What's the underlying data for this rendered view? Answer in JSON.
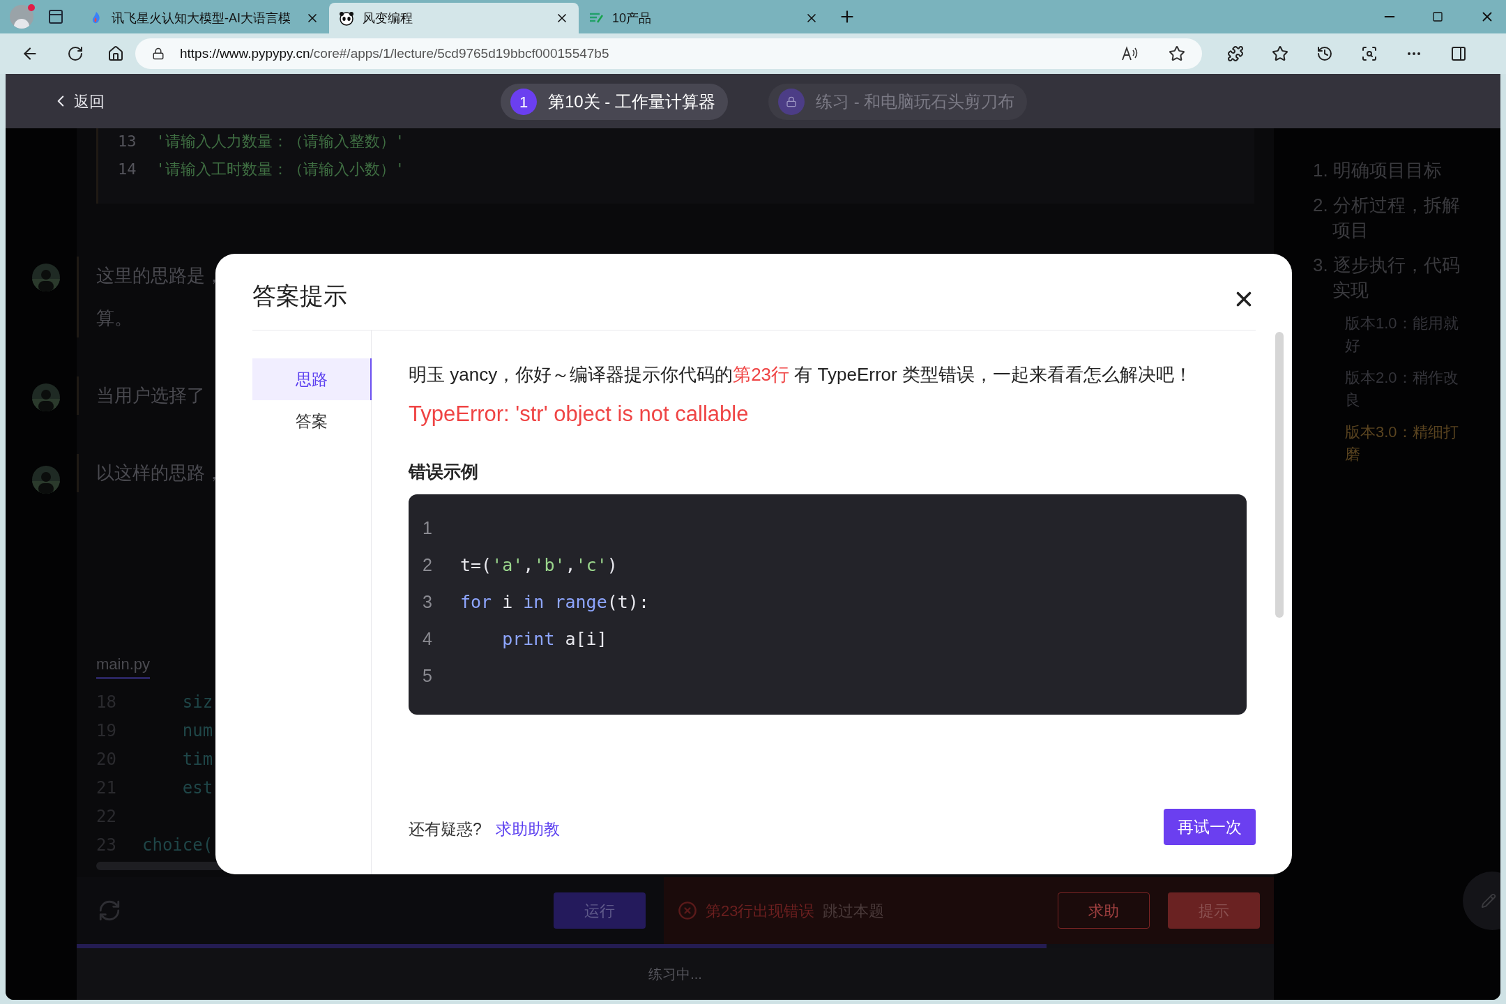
{
  "browser": {
    "tabs": [
      {
        "title": "讯飞星火认知大模型-AI大语言模",
        "selected": false
      },
      {
        "title": "风变编程",
        "selected": true
      },
      {
        "title": "10产品",
        "selected": false
      }
    ],
    "url_host": "https://www.pypypy.cn",
    "url_path": "/core#/apps/1/lecture/5cd9765d19bbcf00015547b5"
  },
  "header": {
    "back_label": "返回",
    "lessons": [
      {
        "kind": "current",
        "number": "1",
        "title": "第10关 - 工作量计算器"
      },
      {
        "kind": "locked",
        "title": "练习 - 和电脑玩石头剪刀布"
      }
    ]
  },
  "snippet": {
    "lines": [
      {
        "number": "13",
        "text": "'请输入人力数量：（请输入整数）'"
      },
      {
        "number": "14",
        "text": "'请输入工时数量：（请输入小数）'"
      }
    ]
  },
  "messages": [
    {
      "lines": [
        "这里的思路是，",
        "算。"
      ]
    },
    {
      "lines": [
        "当用户选择了"
      ]
    },
    {
      "lines": [
        "以这样的思路，"
      ]
    }
  ],
  "editor": {
    "file_tab": "main.py",
    "lines": [
      {
        "number": "18",
        "code": "    siz"
      },
      {
        "number": "19",
        "code": "    num"
      },
      {
        "number": "20",
        "code": "    tim"
      },
      {
        "number": "21",
        "code": "    est"
      },
      {
        "number": "22"
      },
      {
        "number": "23",
        "code": "choice("
      }
    ]
  },
  "toolbar": {
    "run_label": "运行",
    "error_text": "第23行出现错误",
    "skip_label": "跳过本题",
    "help_label": "求助",
    "hint_label": "提示"
  },
  "progress": {
    "level": 0.81
  },
  "status": "练习中...",
  "outline": {
    "items": [
      {
        "text": "1. 明确项目目标"
      },
      {
        "text": "2. 分析过程，拆解项目"
      },
      {
        "text": "3. 逐步执行，代码实现",
        "children": [
          {
            "text": "版本1.0：能用就好",
            "selected": false
          },
          {
            "text": "版本2.0：稍作改良",
            "selected": false
          },
          {
            "text": "版本3.0：精细打磨",
            "selected": true
          }
        ]
      }
    ]
  },
  "modal": {
    "title": "答案提示",
    "tabs": [
      {
        "label": "思路",
        "selected": true
      },
      {
        "label": "答案",
        "selected": false
      }
    ],
    "greeting": {
      "before": "明玉 yancy，你好～编译器提示你代码的",
      "highlight": "第23行",
      "after": " 有 TypeError 类型错误，一起来看看怎么解决吧！"
    },
    "error": "TypeError: 'str' object is not callable",
    "example_title": "错误示例",
    "code": [
      {
        "number": "1"
      },
      {
        "number": "2",
        "tokens": [
          {
            "kind": "plain",
            "text": "t=("
          },
          {
            "kind": "string",
            "text": "'a'"
          },
          {
            "kind": "plain",
            "text": ","
          },
          {
            "kind": "string",
            "text": "'b'"
          },
          {
            "kind": "plain",
            "text": ","
          },
          {
            "kind": "string",
            "text": "'c'"
          },
          {
            "kind": "plain",
            "text": ")"
          }
        ]
      },
      {
        "number": "3",
        "tokens": [
          {
            "kind": "keyword",
            "text": "for"
          },
          {
            "kind": "plain",
            "text": " i "
          },
          {
            "kind": "keyword",
            "text": "in range"
          },
          {
            "kind": "plain",
            "text": "(t):"
          }
        ]
      },
      {
        "number": "4",
        "tokens": [
          {
            "kind": "keyword",
            "text": "    print"
          },
          {
            "kind": "plain",
            "text": " a[i]"
          }
        ]
      },
      {
        "number": "5"
      }
    ],
    "question": "还有疑惑?",
    "help_link": "求助助教",
    "retry_label": "再试一次"
  }
}
